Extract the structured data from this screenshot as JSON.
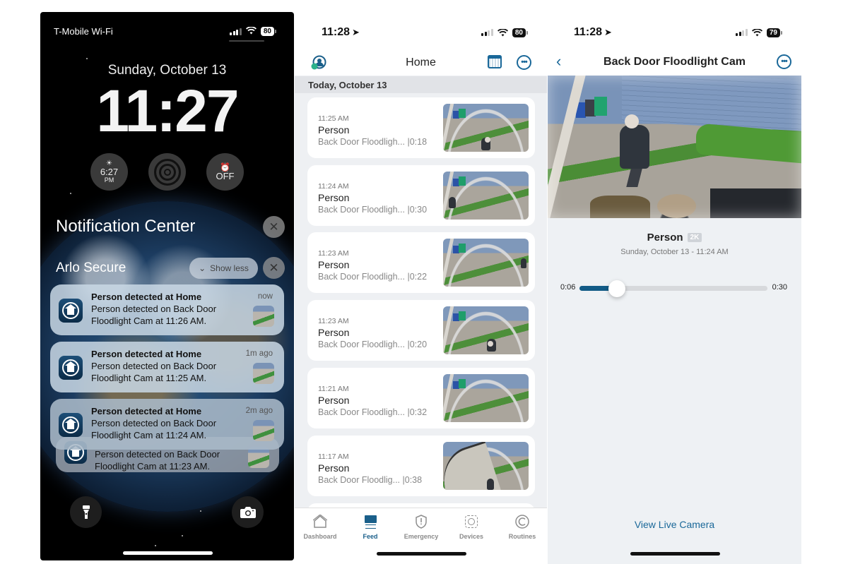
{
  "lock_screen": {
    "carrier": "T-Mobile Wi-Fi",
    "battery": "80",
    "date": "Sunday, October 13",
    "time": "11:27",
    "widgets": {
      "sunset_time": "6:27",
      "sunset_period": "PM",
      "sunset_icon": "sunset-icon",
      "focus_icon": "focus-rings-icon",
      "alarm_icon": "alarm-clock-icon",
      "alarm_state": "OFF"
    },
    "notification_center_title": "Notification Center",
    "clear_icon": "✕",
    "group_title": "Arlo Secure",
    "show_less_label": "Show less",
    "notifications": [
      {
        "title": "Person detected at Home",
        "body": "Person detected on Back Door Floodlight Cam at 11:26 AM.",
        "time": "now"
      },
      {
        "title": "Person detected at Home",
        "body": "Person detected on Back Door Floodlight Cam at 11:25 AM.",
        "time": "1m ago"
      },
      {
        "title": "Person detected at Home",
        "body": "Person detected on Back Door Floodlight Cam at 11:24 AM.",
        "time": "2m ago"
      },
      {
        "title": "",
        "body": "Person detected on Back Door Floodlight Cam at 11:23 AM.",
        "time": ""
      }
    ],
    "flashlight_icon": "flashlight-icon",
    "camera_icon": "camera-icon"
  },
  "feed": {
    "status_time": "11:28",
    "battery": "80",
    "header_title": "Home",
    "day_header": "Today, October 13",
    "events": [
      {
        "time": "11:25 AM",
        "type": "Person",
        "detail": "Back Door Floodligh... |0:18"
      },
      {
        "time": "11:24 AM",
        "type": "Person",
        "detail": "Back Door Floodligh... |0:30"
      },
      {
        "time": "11:23 AM",
        "type": "Person",
        "detail": "Back Door Floodligh... |0:22"
      },
      {
        "time": "11:23 AM",
        "type": "Person",
        "detail": "Back Door Floodligh... |0:20"
      },
      {
        "time": "11:21 AM",
        "type": "Person",
        "detail": "Back Door Floodligh... |0:32"
      },
      {
        "time": "11:17 AM",
        "type": "Person",
        "detail": "Back Door Floodlig...   |0:38"
      }
    ],
    "tabs": [
      {
        "label": "Dashboard",
        "icon": "house-icon",
        "active": false
      },
      {
        "label": "Feed",
        "icon": "feed-icon",
        "active": true
      },
      {
        "label": "Emergency",
        "icon": "shield-alert-icon",
        "active": false
      },
      {
        "label": "Devices",
        "icon": "devices-icon",
        "active": false
      },
      {
        "label": "Routines",
        "icon": "routines-icon",
        "active": false
      }
    ],
    "accent_color": "#1a5f8a"
  },
  "player": {
    "status_time": "11:28",
    "battery": "79",
    "header_title": "Back Door Floodlight Cam",
    "event_type": "Person",
    "quality_badge": "2K",
    "event_datetime": "Sunday, October 13 - 11:24 AM",
    "position_label": "0:06",
    "duration_label": "0:30",
    "progress_fraction": 0.2,
    "view_live_label": "View Live Camera",
    "accent_color": "#125b86"
  }
}
